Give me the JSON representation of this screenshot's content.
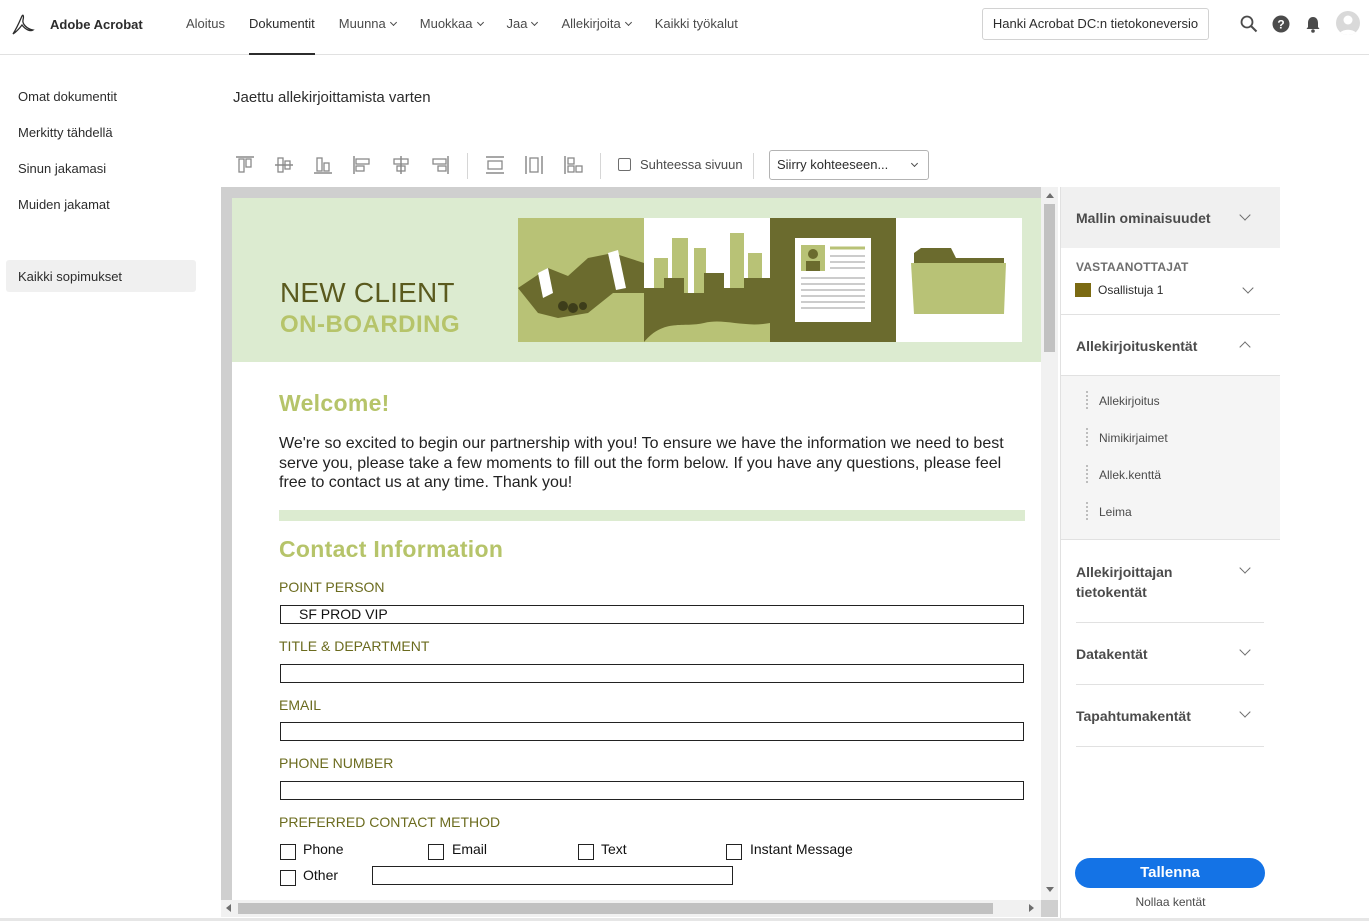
{
  "app": {
    "brand": "Adobe Acrobat"
  },
  "nav": {
    "items": [
      {
        "label": "Aloitus",
        "active": false,
        "dropdown": false
      },
      {
        "label": "Dokumentit",
        "active": true,
        "dropdown": false
      },
      {
        "label": "Muunna",
        "active": false,
        "dropdown": true
      },
      {
        "label": "Muokkaa",
        "active": false,
        "dropdown": true
      },
      {
        "label": "Jaa",
        "active": false,
        "dropdown": true
      },
      {
        "label": "Allekirjoita",
        "active": false,
        "dropdown": true
      },
      {
        "label": "Kaikki työkalut",
        "active": false,
        "dropdown": false
      }
    ],
    "get_desktop": "Hanki Acrobat DC:n tietokoneversio",
    "icons": [
      "search-icon",
      "help-icon",
      "bell-icon",
      "avatar"
    ]
  },
  "sidebar": {
    "items": [
      {
        "label": "Omat dokumentit"
      },
      {
        "label": "Merkitty tähdellä"
      },
      {
        "label": "Sinun jakamasi"
      },
      {
        "label": "Muiden jakamat"
      }
    ],
    "selected": "Kaikki sopimukset"
  },
  "doc": {
    "title": "Jaettu allekirjoittamista varten"
  },
  "toolbar": {
    "icons": [
      "align-top-icon",
      "align-middle-icon",
      "align-bottom-icon",
      "align-left-icon",
      "align-center-icon",
      "align-right-icon",
      "distribute-vertical-icon",
      "distribute-horizontal-icon",
      "match-size-icon"
    ],
    "fit_label": "Suhteessa sivuun",
    "goto_label": "Siirry kohteeseen..."
  },
  "page": {
    "banner_title": "NEW CLIENT",
    "banner_subtitle": "ON-BOARDING",
    "welcome": "Welcome!",
    "intro": "We're so excited to begin our partnership with you! To ensure we have the information we need to best serve you, please take a few moments to fill out the form below. If you have any questions, please feel free to contact us at any time. Thank you!",
    "contact_heading": "Contact Information",
    "fields": [
      {
        "label": "POINT PERSON",
        "value": "SF PROD VIP"
      },
      {
        "label": "TITLE & DEPARTMENT",
        "value": ""
      },
      {
        "label": "EMAIL",
        "value": ""
      },
      {
        "label": "PHONE NUMBER",
        "value": ""
      }
    ],
    "contact_method_label": "PREFERRED CONTACT METHOD",
    "contact_options": [
      "Phone",
      "Email",
      "Text",
      "Instant Message",
      "Other"
    ]
  },
  "right_panel": {
    "template_props": "Mallin ominaisuudet",
    "recipients_label": "VASTAANOTTAJAT",
    "recipient": "Osallistuja 1",
    "recipient_color": "#7b6a12",
    "sig_fields": "Allekirjoituskentät",
    "sig_items": [
      "Allekirjoitus",
      "Nimikirjaimet",
      "Allek.kenttä",
      "Leima"
    ],
    "signer_info_line1": "Allekirjoittajan",
    "signer_info_line2": "tietokentät",
    "data_fields": "Datakentät",
    "event_fields": "Tapahtumakentät",
    "save": "Tallenna",
    "reset": "Nollaa kentät"
  },
  "colors": {
    "accent": "#1473e6",
    "banner_bg": "#dcebd0",
    "olive": "#6b6b1e",
    "green_light": "#b6c46a"
  }
}
